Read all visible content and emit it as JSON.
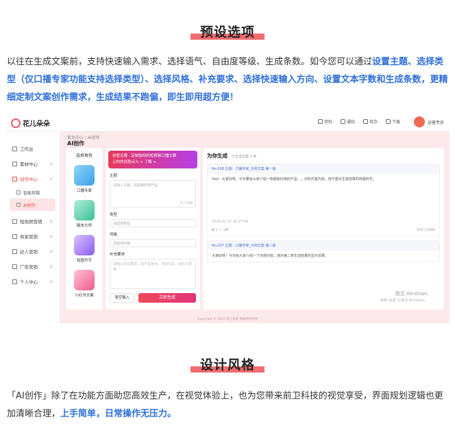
{
  "section1": {
    "title": "预设选项"
  },
  "para1": {
    "t1": "以往在生成文案前，支持快速输入需求、选择语气、自由度等级、生成条数。如今您可以通过",
    "h1": "设置主题、选择类型（仅口播专家功能支持选择类型）、选择风格、补充要求、选择快速输入方向、设置文本字数和生成条数，更精细定制文案创作需求，生成结果不跑偏，即生即用超方便！"
  },
  "app": {
    "brand": "花儿朵朵",
    "top_actions": [
      "资料",
      "通知",
      "待办",
      "下载"
    ],
    "username": "运营专员",
    "breadcrumb": "首页中心 / AI创作",
    "page_title": "AI创作",
    "sidebar": [
      {
        "label": "工作台"
      },
      {
        "label": "素材中心"
      },
      {
        "label": "创作中心"
      },
      {
        "label": "智能剪辑"
      },
      {
        "label": "AI创作"
      },
      {
        "label": "短视频营销"
      },
      {
        "label": "商家营销"
      },
      {
        "label": "达人营销"
      },
      {
        "label": "广告营销"
      },
      {
        "label": "个人中心"
      }
    ],
    "role_label": "选择角色",
    "roles": [
      "口播专家",
      "脚本大师",
      "短图写手",
      "小红书文案"
    ],
    "promo_line1": "创意无限 · 定制独特的短视频口播文案",
    "promo_line2": "让你的创意点火 > 了解 >",
    "theme_label": "主题",
    "theme_placeholder": "请输入主题，如品牌名称产品",
    "theme_count": "0 / 100",
    "type_label": "类型",
    "type_placeholder": "请选择类型",
    "style_label": "风格",
    "style_placeholder": "请选择风格",
    "extra_label": "补充要求",
    "extra_placeholder": "请输入补充要求，如产品卖点、活动信息、目标人群等",
    "clear_label": "清空输入",
    "generate_label": "立即生成",
    "result_title": "为你生成",
    "result_sub": "已生成文案 2 条",
    "card1_head": "No.008 主题：口播专家_示例文案 第一版",
    "card1_body": "Hey！大家好呀，今天要给大家介绍一款超级好用的产品……示例文案内容，用于展示生成结果的排版样式。",
    "card1_meta": "2024-01-27 15:27:09",
    "card1_count": "325 / 1000",
    "card2_head": "No.007 主题：口播专家_示例文案 第二版",
    "card2_body": "大家好呀！今天给大家介绍一下示例内容，演示第二条生成结果的显示效果。",
    "watermark1": "激活 Windows",
    "watermark2": "转到“设置”以激活 Windows。",
    "copyright": "Copyright © 2024 花儿朵朵 保留所有权利"
  },
  "section2": {
    "title": "设计风格"
  },
  "para2": {
    "t1": "「AI创作」除了在功能方面助您高效生产，在视觉体验上，也为您带来前卫科技的视觉享受，界面规划逻辑也更加清晰合理，",
    "h1": "上手简单，日常操作无压力。"
  },
  "colors": {
    "accent": "#f36c6f",
    "highlight": "#2f6fd8",
    "brand": "#e2463f"
  }
}
